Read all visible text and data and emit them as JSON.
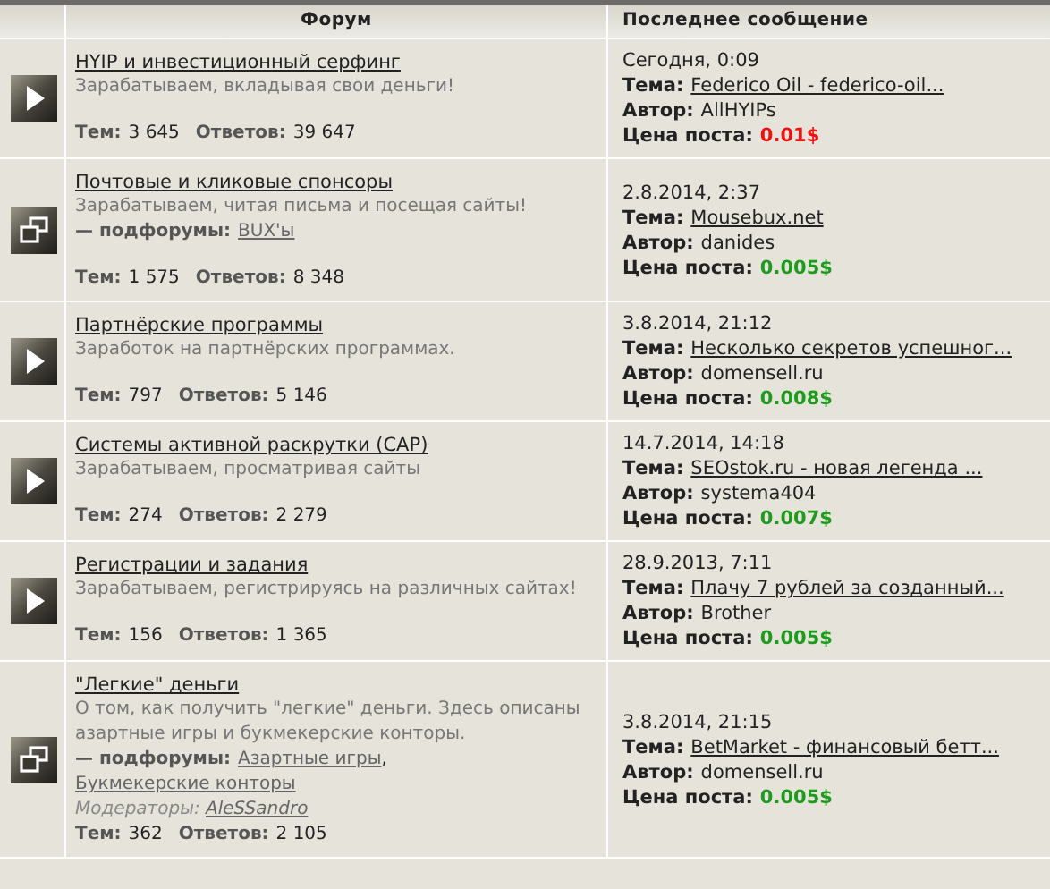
{
  "header": {
    "columns": [
      "Форум",
      "Последнее сообщение"
    ]
  },
  "forums": [
    {
      "kind": "forum",
      "title": "HYIP и инвестиционный серфинг",
      "description": "Зарабатываем, вкладывая свои деньги!",
      "stats": [
        {
          "label": "Тем:",
          "value": "3 645"
        },
        {
          "label": "Ответов:",
          "value": "39 647"
        }
      ],
      "last": {
        "date": "Сегодня, 0:09",
        "topic_label": "Тема:",
        "topic": "Federico Oil - federico-oil...",
        "author_label": "Автор:",
        "author": "AllHYIPs",
        "price_label": "Цена поста:",
        "price": "0.01$",
        "color": "#ee1111"
      }
    },
    {
      "kind": "subforums",
      "title": "Почтовые и кликовые спонсоры",
      "description": "Зарабатываем, читая письма и посещая сайты!",
      "subforums_label": "— подфорумы:",
      "subforums": [
        "BUX'ы"
      ],
      "stats": [
        {
          "label": "Тем:",
          "value": "1 575"
        },
        {
          "label": "Ответов:",
          "value": "8 348"
        }
      ],
      "last": {
        "date": "2.8.2014, 2:37",
        "topic_label": "Тема:",
        "topic": "Mousebux.net",
        "author_label": "Автор:",
        "author": "danides",
        "price_label": "Цена поста:",
        "price": "0.005$",
        "color": "#1e9a1e"
      }
    },
    {
      "kind": "forum",
      "title": "Партнёрские программы",
      "description": "Заработок на партнёрских программах.",
      "stats": [
        {
          "label": "Тем:",
          "value": "797"
        },
        {
          "label": "Ответов:",
          "value": "5 146"
        }
      ],
      "last": {
        "date": "3.8.2014, 21:12",
        "topic_label": "Тема:",
        "topic": "Несколько секретов успешног...",
        "author_label": "Автор:",
        "author": "domensell.ru",
        "price_label": "Цена поста:",
        "price": "0.008$",
        "color": "#1e9a1e"
      }
    },
    {
      "kind": "forum",
      "title": "Системы активной раскрутки (САР)",
      "description": "Зарабатываем, просматривая сайты",
      "stats": [
        {
          "label": "Тем:",
          "value": "274"
        },
        {
          "label": "Ответов:",
          "value": "2 279"
        }
      ],
      "last": {
        "date": "14.7.2014, 14:18",
        "topic_label": "Тема:",
        "topic": "SEOstok.ru - новая легенда ...",
        "author_label": "Автор:",
        "author": "systema404",
        "price_label": "Цена поста:",
        "price": "0.007$",
        "color": "#1e9a1e"
      }
    },
    {
      "kind": "forum",
      "title": "Регистрации и задания",
      "description": "Зарабатываем, регистрируясь на различных сайтах!",
      "stats": [
        {
          "label": "Тем:",
          "value": "156"
        },
        {
          "label": "Ответов:",
          "value": "1 365"
        }
      ],
      "last": {
        "date": "28.9.2013, 7:11",
        "topic_label": "Тема:",
        "topic": "Плачу 7 рублей за созданный...",
        "author_label": "Автор:",
        "author": "Brother",
        "price_label": "Цена поста:",
        "price": "0.005$",
        "color": "#1e9a1e"
      }
    },
    {
      "kind": "subforums",
      "title": "\"Легкие\" деньги",
      "description": "О том, как получить \"легкие\" деньги. Здесь описаны азартные игры и букмекерские конторы.",
      "subforums_label": "— подфорумы:",
      "subforums": [
        "Азартные игры",
        "Букмекерские конторы"
      ],
      "subforum_separator": ",",
      "moderators_label": "Модераторы:",
      "moderators": [
        "AleSSandro"
      ],
      "stats": [
        {
          "label": "Тем:",
          "value": "362"
        },
        {
          "label": "Ответов:",
          "value": "2 105"
        }
      ],
      "last": {
        "date": "3.8.2014, 21:15",
        "topic_label": "Тема:",
        "topic": "BetMarket - финансовый бетт...",
        "author_label": "Автор:",
        "author": "domensell.ru",
        "price_label": "Цена поста:",
        "price": "0.005$",
        "color": "#1e9a1e"
      }
    }
  ]
}
